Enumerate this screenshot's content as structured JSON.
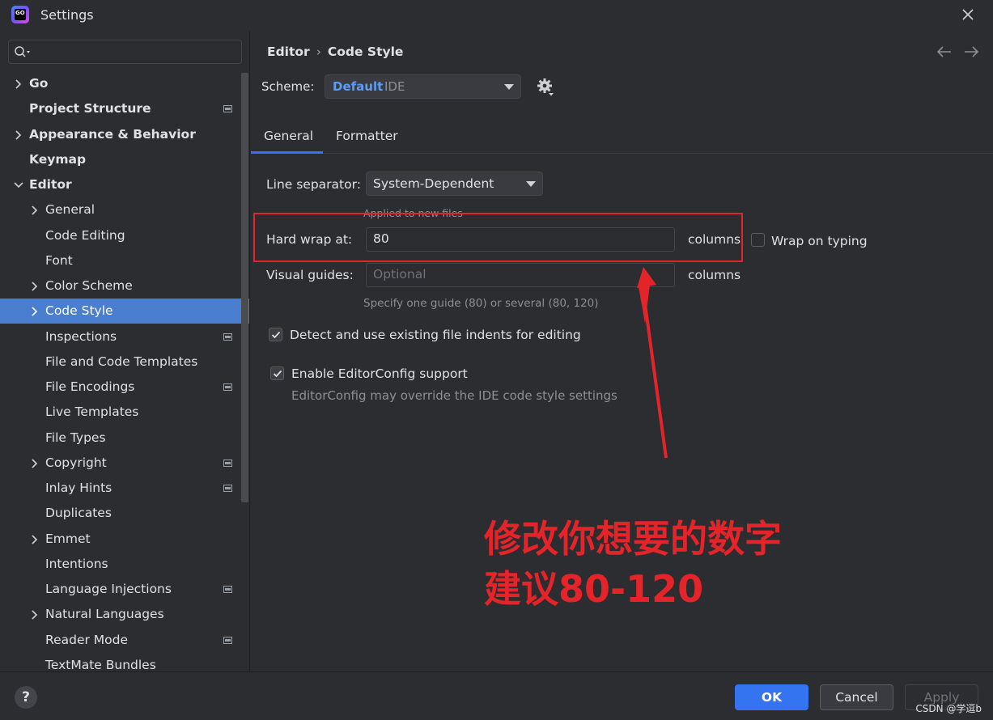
{
  "window": {
    "title": "Settings",
    "logo_text": "GO"
  },
  "search": {
    "placeholder": ""
  },
  "sidebar": {
    "items": [
      {
        "label": "Go",
        "bold": true,
        "chevron": "right",
        "level": 0,
        "pinned": false
      },
      {
        "label": "Project Structure",
        "bold": true,
        "chevron": "none",
        "level": 0,
        "pinned": true
      },
      {
        "label": "Appearance & Behavior",
        "bold": true,
        "chevron": "right",
        "level": 0,
        "pinned": false
      },
      {
        "label": "Keymap",
        "bold": true,
        "chevron": "none",
        "level": 0,
        "pinned": false
      },
      {
        "label": "Editor",
        "bold": true,
        "chevron": "down",
        "level": 0,
        "pinned": false
      },
      {
        "label": "General",
        "bold": false,
        "chevron": "right",
        "level": 1,
        "pinned": false
      },
      {
        "label": "Code Editing",
        "bold": false,
        "chevron": "none",
        "level": 1,
        "pinned": false
      },
      {
        "label": "Font",
        "bold": false,
        "chevron": "none",
        "level": 1,
        "pinned": false
      },
      {
        "label": "Color Scheme",
        "bold": false,
        "chevron": "right",
        "level": 1,
        "pinned": false
      },
      {
        "label": "Code Style",
        "bold": false,
        "chevron": "right",
        "level": 1,
        "pinned": false,
        "selected": true
      },
      {
        "label": "Inspections",
        "bold": false,
        "chevron": "none",
        "level": 1,
        "pinned": true
      },
      {
        "label": "File and Code Templates",
        "bold": false,
        "chevron": "none",
        "level": 1,
        "pinned": false
      },
      {
        "label": "File Encodings",
        "bold": false,
        "chevron": "none",
        "level": 1,
        "pinned": true
      },
      {
        "label": "Live Templates",
        "bold": false,
        "chevron": "none",
        "level": 1,
        "pinned": false
      },
      {
        "label": "File Types",
        "bold": false,
        "chevron": "none",
        "level": 1,
        "pinned": false
      },
      {
        "label": "Copyright",
        "bold": false,
        "chevron": "right",
        "level": 1,
        "pinned": true
      },
      {
        "label": "Inlay Hints",
        "bold": false,
        "chevron": "none",
        "level": 1,
        "pinned": true
      },
      {
        "label": "Duplicates",
        "bold": false,
        "chevron": "none",
        "level": 1,
        "pinned": false
      },
      {
        "label": "Emmet",
        "bold": false,
        "chevron": "right",
        "level": 1,
        "pinned": false
      },
      {
        "label": "Intentions",
        "bold": false,
        "chevron": "none",
        "level": 1,
        "pinned": false
      },
      {
        "label": "Language Injections",
        "bold": false,
        "chevron": "none",
        "level": 1,
        "pinned": true
      },
      {
        "label": "Natural Languages",
        "bold": false,
        "chevron": "right",
        "level": 1,
        "pinned": false
      },
      {
        "label": "Reader Mode",
        "bold": false,
        "chevron": "none",
        "level": 1,
        "pinned": true
      },
      {
        "label": "TextMate Bundles",
        "bold": false,
        "chevron": "none",
        "level": 1,
        "pinned": false
      }
    ]
  },
  "main": {
    "breadcrumb": {
      "parent": "Editor",
      "separator": "›",
      "current": "Code Style"
    },
    "scheme": {
      "label": "Scheme:",
      "name": "Default",
      "sub": "IDE"
    },
    "tabs": [
      {
        "label": "General",
        "active": true
      },
      {
        "label": "Formatter",
        "active": false
      }
    ],
    "line_separator": {
      "label": "Line separator:",
      "value": "System-Dependent",
      "hint": "Applied to new files"
    },
    "hard_wrap": {
      "label": "Hard wrap at:",
      "value": "80",
      "unit": "columns"
    },
    "wrap_on_typing": {
      "label": "Wrap on typing",
      "checked": false
    },
    "visual_guides": {
      "label": "Visual guides:",
      "placeholder": "Optional",
      "unit": "columns",
      "hint": "Specify one guide (80) or several (80, 120)"
    },
    "detect_indents": {
      "label": "Detect and use existing file indents for editing",
      "checked": true
    },
    "editorconfig": {
      "label": "Enable EditorConfig support",
      "checked": true,
      "hint": "EditorConfig may override the IDE code style settings"
    }
  },
  "annotation": {
    "line1": "修改你想要的数字",
    "line2": "建议80-120",
    "color": "#e5242a"
  },
  "footer": {
    "help_label": "?",
    "ok_label": "OK",
    "cancel_label": "Cancel",
    "apply_label": "Apply",
    "watermark": "CSDN @学逗b"
  },
  "colors": {
    "background": "#2b2d30",
    "selection": "#4a7fcf",
    "accent": "#3574f0",
    "scheme_name": "#5d9cf5"
  }
}
